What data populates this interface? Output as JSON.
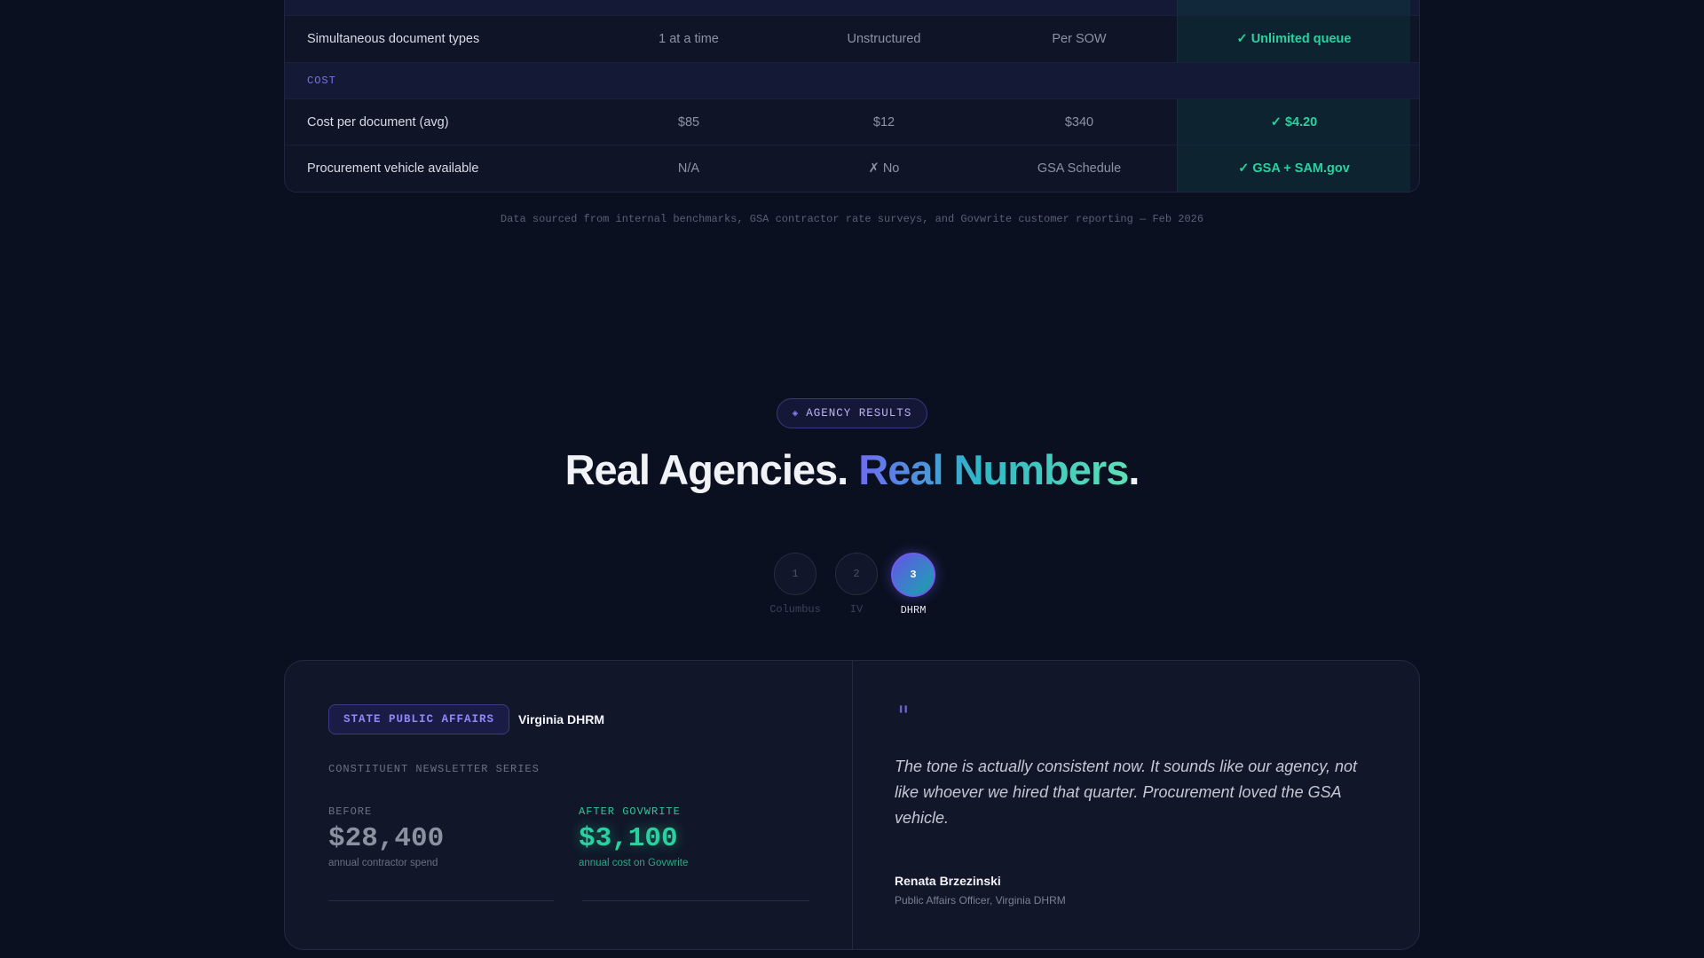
{
  "comparison": {
    "rows": [
      {
        "label": "Simultaneous document types",
        "in_house": "1 at a time",
        "freelancer": "Unstructured",
        "agency": "Per SOW",
        "govwrite": "✓ Unlimited queue"
      }
    ],
    "category": "COST",
    "cost_rows": [
      {
        "label": "Cost per document (avg)",
        "in_house": "$85",
        "freelancer": "$12",
        "agency": "$340",
        "govwrite": "✓ $4.20"
      },
      {
        "label": "Procurement vehicle available",
        "in_house": "N/A",
        "freelancer": "✗ No",
        "agency": "GSA Schedule",
        "govwrite": "✓ GSA + SAM.gov"
      }
    ],
    "footnote": "Data sourced from internal benchmarks, GSA contractor rate surveys, and Govwrite customer reporting — Feb 2026"
  },
  "results": {
    "pill_icon": "diamond-icon",
    "pill_label": "AGENCY RESULTS",
    "headline_plain": "Real Agencies. ",
    "headline_accent": "Real Numbers",
    "headline_end": ".",
    "steps": [
      {
        "number": "1",
        "name": "Columbus"
      },
      {
        "number": "2",
        "name": "IV"
      },
      {
        "number": "3",
        "name": "DHRM"
      }
    ],
    "active_step": 3
  },
  "case": {
    "badge": "STATE PUBLIC AFFAIRS",
    "agency": "Virginia DHRM",
    "series": "CONSTITUENT NEWSLETTER SERIES",
    "before_label": "BEFORE",
    "before_value": "$28,400",
    "before_note": "annual contractor spend",
    "after_label": "AFTER GOVWRITE",
    "after_value": "$3,100",
    "after_note": "annual cost on Govwrite",
    "quote_mark": "\"",
    "quote": "The tone is actually consistent now. It sounds like our agency, not like whoever we hired that quarter. Procurement loved the GSA vehicle.",
    "author": "Renata Brzezinski",
    "role": "Public Affairs Officer, Virginia DHRM"
  },
  "colors": {
    "background": "#0b1020",
    "accent_purple": "#7c6ff0",
    "accent_green": "#2ad1a0"
  }
}
